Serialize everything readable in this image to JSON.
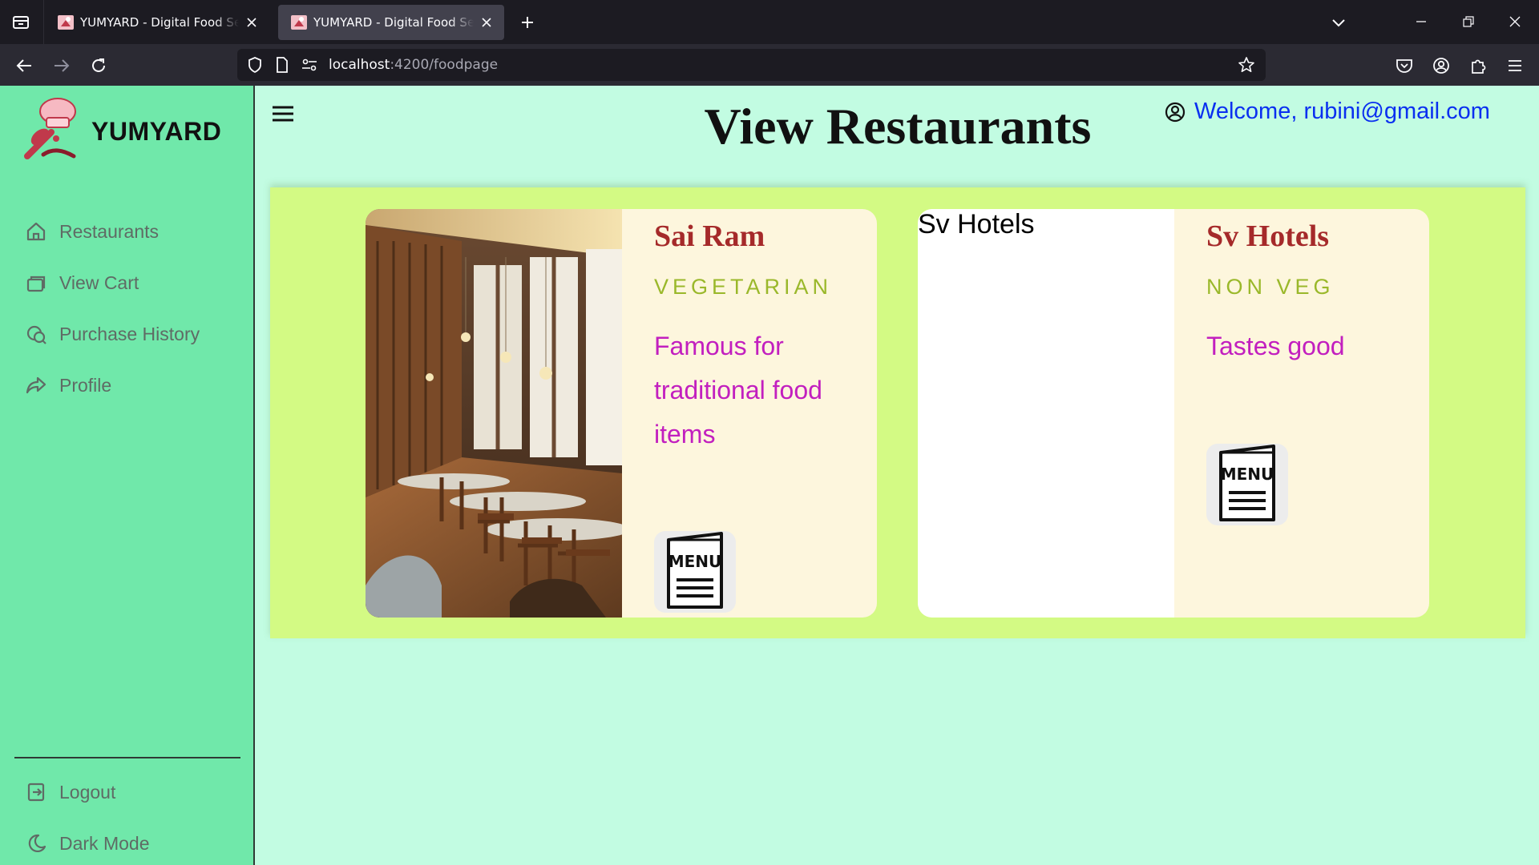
{
  "browser": {
    "tabs": [
      {
        "title": "YUMYARD - Digital Food Service",
        "active": false
      },
      {
        "title": "YUMYARD - Digital Food Service",
        "active": true
      }
    ],
    "url": {
      "host": "localhost",
      "path": ":4200/foodpage"
    }
  },
  "sidebar": {
    "brand": "YUMYARD",
    "items": [
      {
        "label": "Restaurants",
        "icon": "home-icon"
      },
      {
        "label": "View Cart",
        "icon": "cart-icon"
      },
      {
        "label": "Purchase History",
        "icon": "history-icon"
      },
      {
        "label": "Profile",
        "icon": "share-icon"
      }
    ],
    "bottom_items": [
      {
        "label": "Logout",
        "icon": "logout-icon"
      },
      {
        "label": "Dark Mode",
        "icon": "moon-icon"
      }
    ]
  },
  "header": {
    "title": "View Restaurants",
    "welcome": "Welcome, rubini@gmail.com"
  },
  "restaurants": [
    {
      "name": "Sai Ram",
      "type": "VEGETARIAN",
      "description": "Famous for traditional food items",
      "image_alt": "",
      "menu_label": "MENU"
    },
    {
      "name": "Sv Hotels",
      "type": "NON VEG",
      "description": "Tastes good",
      "image_alt": "Sv Hotels",
      "menu_label": "MENU"
    }
  ],
  "colors": {
    "page_bg": "#c2fce2",
    "sidebar_bg": "#70e8aa",
    "restaurants_bg": "#d3fa84",
    "card_bg": "#fdf6dd",
    "name_color": "#a52a2a",
    "type_color": "#9ab82a",
    "desc_color": "#c21fbf",
    "welcome_color": "#0a2ff0"
  }
}
